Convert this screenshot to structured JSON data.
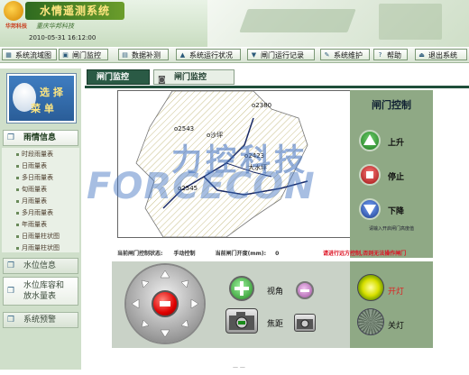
{
  "header": {
    "app_title": "水情遥测系统",
    "subtitle": "重庆华邦科技",
    "brand": "华邦科技",
    "datetime": "2010-05-31 16:12:00"
  },
  "menu": [
    {
      "label": "系统流域图",
      "icon": "map-icon"
    },
    {
      "label": "闸门监控",
      "icon": "gate-icon"
    },
    {
      "label": "数据补测",
      "icon": "data-icon"
    },
    {
      "label": "系统运行状况",
      "icon": "status-icon"
    },
    {
      "label": "闸门运行记录",
      "icon": "record-icon"
    },
    {
      "label": "系统维护",
      "icon": "wrench-icon"
    },
    {
      "label": "帮助",
      "icon": "help-icon"
    },
    {
      "label": "退出系统",
      "icon": "exit-icon"
    }
  ],
  "sidebar": {
    "select_menu_1": "选 择",
    "select_menu_2": "菜 单",
    "rain_info": "雨情信息",
    "rain_items": [
      "时段雨量表",
      "日雨量表",
      "多日雨量表",
      "旬雨量表",
      "月雨量表",
      "多月雨量表",
      "年雨量表",
      "日雨量柱状图",
      "月雨量柱状图"
    ],
    "water_level": "水位信息",
    "capacity_1": "水位库容和",
    "capacity_2": "放水量表",
    "warning": "系统预警"
  },
  "tabs": {
    "active": "闸门监控",
    "secondary": "闸门监控"
  },
  "map": {
    "labels": [
      "o2380",
      "o2543",
      "o沙坪",
      "o2423",
      "大水坪",
      "o2545"
    ]
  },
  "watermark": {
    "cn": "力控科技",
    "en": "FORCECON"
  },
  "gate_control": {
    "title": "闸门控制",
    "up": "上升",
    "stop": "停止",
    "down": "下降",
    "note": "请输入开启闸门高度值"
  },
  "status": {
    "control_mode_label": "当前闸门控制状态:",
    "control_mode_value": "手动控制",
    "opening_label": "当前闸门开度(mm):",
    "opening_value": "0",
    "warning": "请进行远方控制,否则无法操作闸门"
  },
  "camera": {
    "zoom_label": "视角",
    "focus_label": "焦距",
    "light_on": "开灯",
    "light_off": "关灯"
  },
  "colors": {
    "panel_green": "#8fa985",
    "tab_dark": "#2a5a45",
    "center_red": "#e00000"
  }
}
